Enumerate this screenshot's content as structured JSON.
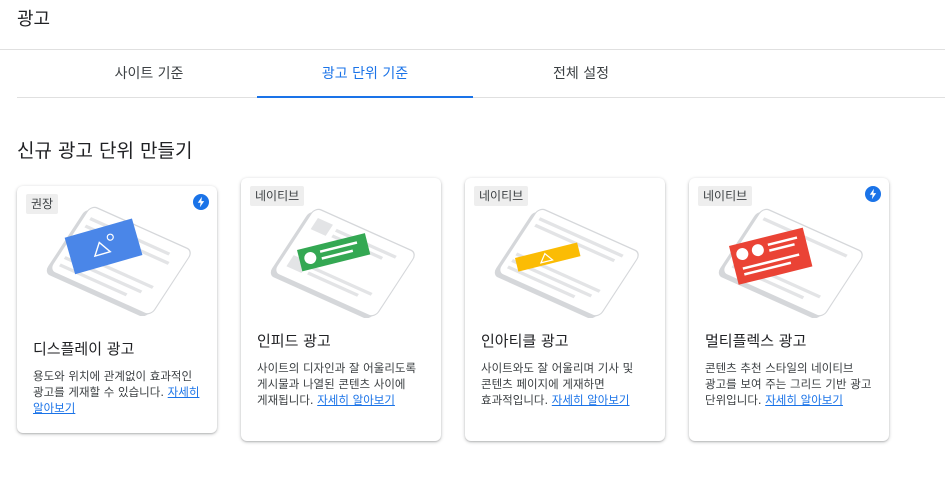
{
  "page": {
    "title": "광고"
  },
  "tabs": [
    {
      "label": "사이트 기준",
      "active": false
    },
    {
      "label": "광고 단위 기준",
      "active": true
    },
    {
      "label": "전체 설정",
      "active": false
    }
  ],
  "section": {
    "title": "신규 광고 단위 만들기"
  },
  "colors": {
    "accent": "#1a73e8",
    "display": "#4a86e8",
    "infeed": "#34a853",
    "inarticle": "#fbbc04",
    "multiplex": "#ea4335"
  },
  "cards": [
    {
      "chip": "권장",
      "badge_icon": "lightning-bolt-icon",
      "title": "디스플레이 광고",
      "description": "용도와 위치에 관계없이 효과적인 광고를 게재할 수 있습니다.",
      "link": "자세히 알아보기"
    },
    {
      "chip": "네이티브",
      "title": "인피드 광고",
      "description": "사이트의 디자인과 잘 어울리도록 게시물과 나열된 콘텐츠 사이에 게재됩니다.",
      "link": "자세히 알아보기"
    },
    {
      "chip": "네이티브",
      "title": "인아티클 광고",
      "description": "사이트와도 잘 어울리며 기사 및 콘텐츠 페이지에 게재하면 효과적입니다.",
      "link": "자세히 알아보기"
    },
    {
      "chip": "네이티브",
      "badge_icon": "lightning-bolt-icon",
      "title": "멀티플렉스 광고",
      "description": "콘텐츠 추천 스타일의 네이티브 광고를 보여 주는 그리드 기반 광고 단위입니다.",
      "link": "자세히 알아보기"
    }
  ]
}
